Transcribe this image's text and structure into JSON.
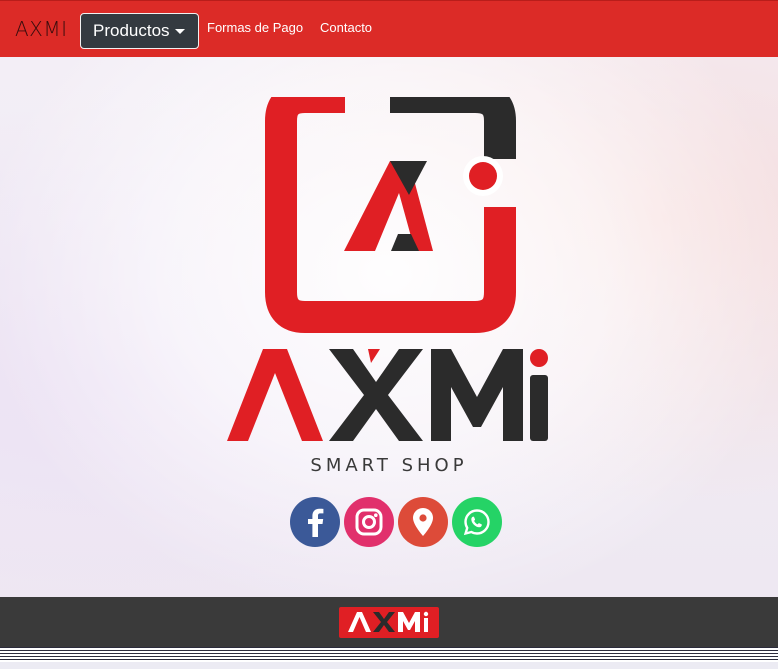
{
  "navbar": {
    "brand": "AXMI",
    "dropdown_label": "Productos",
    "links": [
      "Formas de Pago",
      "Contacto"
    ]
  },
  "hero": {
    "logo_wordmark": "AXMi",
    "tagline": "SMART SHOP",
    "socials": [
      {
        "name": "facebook",
        "icon": "facebook-icon",
        "color": "#3b5998"
      },
      {
        "name": "instagram",
        "icon": "instagram-icon",
        "color": "#e1306c"
      },
      {
        "name": "location",
        "icon": "map-pin-icon",
        "color": "#dd4b39"
      },
      {
        "name": "whatsapp",
        "icon": "whatsapp-icon",
        "color": "#25d366"
      }
    ]
  },
  "footer": {
    "logo_text": "AXMi"
  },
  "colors": {
    "brand_red": "#dc2b27",
    "logo_red": "#e01f24",
    "dark": "#343a40",
    "footer": "#3a3a3a"
  }
}
